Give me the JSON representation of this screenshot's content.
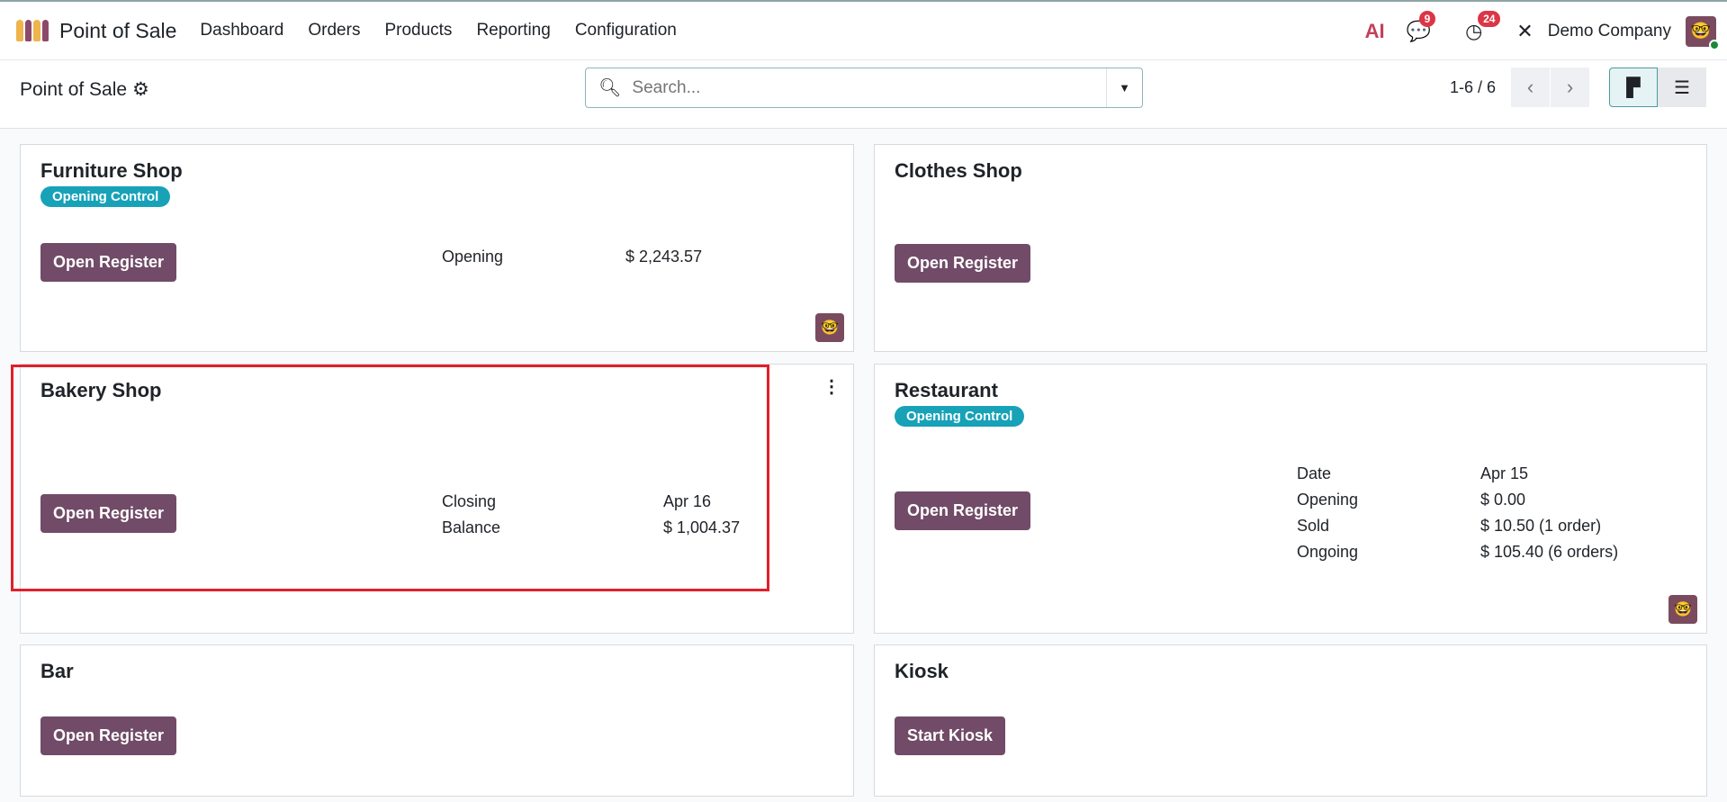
{
  "navbar": {
    "app_title": "Point of Sale",
    "menu": [
      "Dashboard",
      "Orders",
      "Products",
      "Reporting",
      "Configuration"
    ],
    "ai_label": "AI",
    "messages_count": "9",
    "activities_count": "24",
    "company": "Demo Company"
  },
  "control_panel": {
    "title": "Point of Sale",
    "search_placeholder": "Search...",
    "pager": "1-6 / 6"
  },
  "cards": [
    {
      "title": "Furniture Shop",
      "tag": "Opening Control",
      "button": "Open Register",
      "rows": [
        [
          "Opening",
          "$ 2,243.57"
        ]
      ]
    },
    {
      "title": "Clothes Shop",
      "button": "Open Register"
    },
    {
      "title": "Bakery Shop",
      "button": "Open Register",
      "rows": [
        [
          "Closing",
          "Apr 16"
        ],
        [
          "Balance",
          "$ 1,004.37"
        ]
      ]
    },
    {
      "title": "Restaurant",
      "tag": "Opening Control",
      "button": "Open Register",
      "rows": [
        [
          "Date",
          "Apr 15"
        ],
        [
          "Opening",
          "$ 0.00"
        ],
        [
          "Sold",
          "$ 10.50 (1 order)"
        ],
        [
          "Ongoing",
          "$ 105.40 (6 orders)"
        ]
      ]
    },
    {
      "title": "Bar",
      "button": "Open Register"
    },
    {
      "title": "Kiosk",
      "button": "Start Kiosk"
    }
  ],
  "colors": {
    "primary": "#714b67",
    "tag": "#17a2b8",
    "badge": "#dc3545",
    "highlight": "#e0202a"
  }
}
